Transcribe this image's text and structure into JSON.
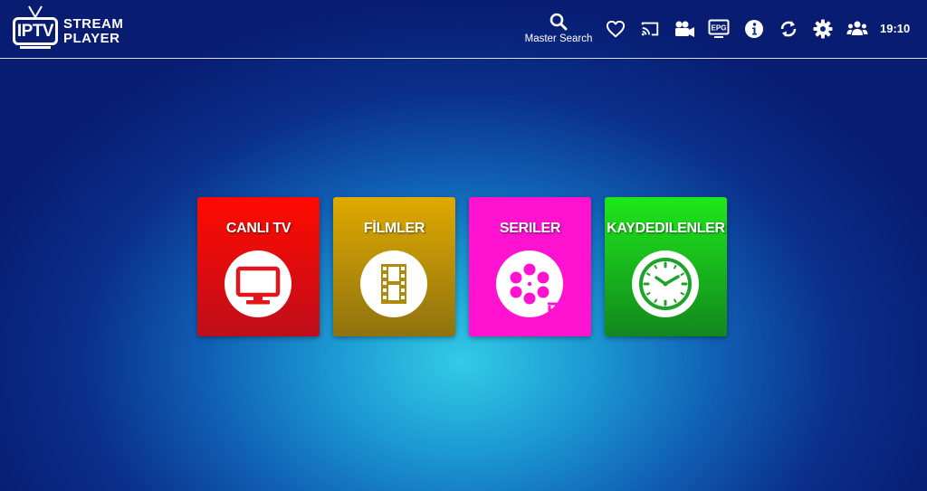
{
  "header": {
    "logo": {
      "badge": "IPTV",
      "line1": "STREAM",
      "line2": "PLAYER"
    },
    "search": {
      "label": "Master Search",
      "icon": "search-icon"
    },
    "icons": [
      "heart-icon",
      "cast-icon",
      "video-camera-icon",
      "epg-icon",
      "info-icon",
      "refresh-icon",
      "gear-icon",
      "users-icon"
    ],
    "epg_badge": "EPG",
    "time": "19:10"
  },
  "tiles": [
    {
      "label": "CANLI TV",
      "icon": "tv-icon",
      "color": "#e81210"
    },
    {
      "label": "FİLMLER",
      "icon": "film-strip-icon",
      "color": "#c49d0a"
    },
    {
      "label": "SERILER",
      "icon": "film-reel-icon",
      "color": "#ff12d0"
    },
    {
      "label": "KAYDEDILENLER",
      "icon": "clock-icon",
      "color": "#19c41b"
    }
  ]
}
